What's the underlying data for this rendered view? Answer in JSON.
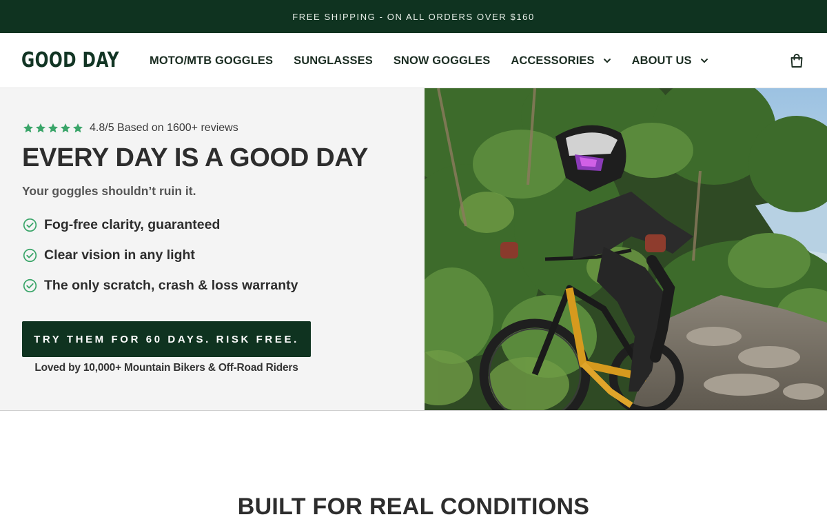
{
  "announcement": "FREE SHIPPING - ON ALL ORDERS OVER $160",
  "brand": {
    "logo": "GOOD DAY"
  },
  "nav": {
    "items": [
      {
        "label": "MOTO/MTB GOGGLES"
      },
      {
        "label": "SUNGLASSES"
      },
      {
        "label": "SNOW GOGGLES"
      },
      {
        "label": "ACCESSORIES",
        "has_dropdown": true
      },
      {
        "label": "ABOUT US",
        "has_dropdown": true
      }
    ],
    "cart_icon": "shopping-bag-icon"
  },
  "hero": {
    "rating": {
      "stars": 5,
      "text": "4.8/5 Based on 1600+ reviews"
    },
    "headline": "EVERY DAY IS A GOOD DAY",
    "subheadline": "Your goggles shouldn’t ruin it.",
    "features": [
      "Fog-free clarity, guaranteed",
      "Clear vision in any light",
      "The only scratch, crash & loss warranty"
    ],
    "cta_label": "TRY THEM FOR 60 DAYS. RISK FREE.",
    "social_proof": "Loved by 10,000+ Mountain Bikers & Off-Road Riders",
    "image": "mountain-biker-riding-rocky-forest-trail"
  },
  "next_section": {
    "title": "BUILT FOR REAL CONDITIONS"
  },
  "colors": {
    "brand_green": "#0f3320",
    "accent_green": "#3aa569",
    "hero_bg": "#f4f4f4",
    "text_dark": "#2d2d2d"
  }
}
